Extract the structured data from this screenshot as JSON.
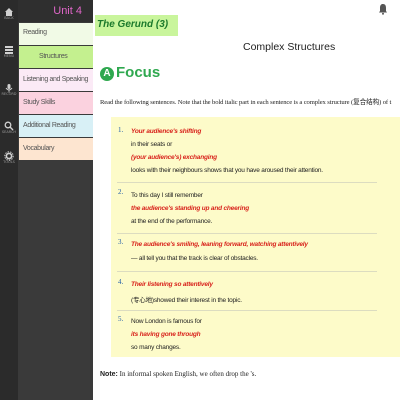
{
  "rail": {
    "items": [
      {
        "label": "BACK",
        "icon": "home-icon"
      },
      {
        "label": "MENU",
        "icon": "menu-icon"
      },
      {
        "label": "RECORD",
        "icon": "microphone-icon"
      },
      {
        "label": "SEARCH",
        "icon": "search-icon"
      },
      {
        "label": "TOOLS",
        "icon": "gear-icon"
      }
    ]
  },
  "sidebar": {
    "unit_title": "Unit 4",
    "items": [
      {
        "label": "Reading"
      },
      {
        "label": "Structures"
      },
      {
        "label": "Listening and Speaking"
      },
      {
        "label": "Study Skills"
      },
      {
        "label": "Additional Reading"
      },
      {
        "label": "Vocabulary"
      }
    ]
  },
  "header": {
    "section_title": "The Gerund (3)",
    "page_title": "Complex Structures"
  },
  "focus": {
    "badge": "A",
    "label": "Focus",
    "instruction": "Read the following sentences. Note that the bold italic part in each sentence is a complex structure (复合结构) of t"
  },
  "sentences": [
    {
      "number": "1.",
      "lines": [
        {
          "text": "Your audience's shifting",
          "style": "red"
        },
        {
          "text": "in their seats or",
          "style": "plain"
        },
        {
          "text": "(your audience's) exchanging",
          "style": "red"
        },
        {
          "text": "looks with their neighbours shows that you have aroused their attention.",
          "style": "plain"
        }
      ]
    },
    {
      "number": "2.",
      "lines": [
        {
          "text": "To this day I still remember",
          "style": "plain"
        },
        {
          "text": "the audience's standing up and cheering",
          "style": "red"
        },
        {
          "text": "at the end of the performance.",
          "style": "plain"
        }
      ]
    },
    {
      "number": "3.",
      "lines": [
        {
          "text": "The audience's smiling, leaning forward, watching attentively",
          "style": "red"
        },
        {
          "text": "— all tell you that the track is clear of obstacles.",
          "style": "plain"
        }
      ]
    },
    {
      "number": "4.",
      "lines": [
        {
          "text": "Their listening so attentively",
          "style": "red"
        },
        {
          "text": "(专心地)showed their interest in the topic.",
          "style": "plain"
        }
      ]
    },
    {
      "number": "5.",
      "lines": [
        {
          "text": "Now London is famous for",
          "style": "plain"
        },
        {
          "text": "its having gone through",
          "style": "red"
        },
        {
          "text": "so many changes.",
          "style": "plain"
        }
      ]
    }
  ],
  "note": {
    "label": "Note:",
    "text": "In informal spoken English, we often drop the 's."
  },
  "colors": {
    "accent_green": "#2fa84f",
    "highlight_red": "#d8231c",
    "unit_pink": "#e066c8",
    "box_yellow": "#fdfbc9"
  }
}
